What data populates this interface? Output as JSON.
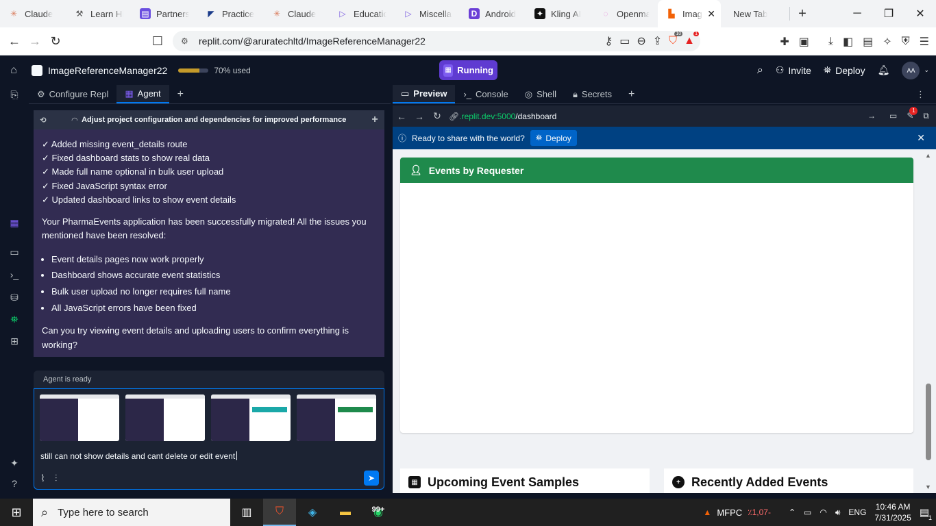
{
  "browser": {
    "tabs": [
      {
        "label": "Claude",
        "icon": "claude-icon",
        "color": "#d97757"
      },
      {
        "label": "Learn Hi",
        "icon": "learn-icon",
        "color": "#555"
      },
      {
        "label": "Partners",
        "icon": "partners-icon",
        "color": "#6b4fe0"
      },
      {
        "label": "Practice",
        "icon": "practice-icon",
        "color": "#1a3b8a"
      },
      {
        "label": "Claude",
        "icon": "claude-icon",
        "color": "#d97757"
      },
      {
        "label": "Educatio",
        "icon": "play-icon",
        "color": "#7b5ce0"
      },
      {
        "label": "Miscellar",
        "icon": "play-icon",
        "color": "#7b5ce0"
      },
      {
        "label": "Android",
        "icon": "d-icon",
        "color": "#6b3fd6"
      },
      {
        "label": "Kling AI",
        "icon": "kling-icon",
        "color": "#111"
      },
      {
        "label": "Openma",
        "icon": "openma-icon",
        "color": "#e58ad9"
      },
      {
        "label": "Imag",
        "icon": "replit-icon",
        "color": "#f26207",
        "active": true
      },
      {
        "label": "New Tab",
        "icon": "",
        "color": ""
      }
    ],
    "address": "replit.com/@aruratechltd/ImageReferenceManager22",
    "brave_badge": "10",
    "alert_badge": "1"
  },
  "replit": {
    "repl_name": "ImageReferenceManager22",
    "usage_label": "70% used",
    "usage_fraction": 0.7,
    "run_status": "Running",
    "invite_label": "Invite",
    "deploy_label": "Deploy",
    "avatar_initials": "AA"
  },
  "left_tabs": {
    "configure": "Configure Repl",
    "agent": "Agent"
  },
  "chat": {
    "header_title": "Adjust project configuration and dependencies for improved performance",
    "checklist": [
      "✓ Added missing event_details route",
      "✓ Fixed dashboard stats to show real data",
      "✓ Made full name optional in bulk user upload",
      "✓ Fixed JavaScript syntax error",
      "✓ Updated dashboard links to show event details"
    ],
    "summary": "Your PharmaEvents application has been successfully migrated! All the issues you mentioned have been resolved:",
    "bullets": [
      "Event details pages now work properly",
      "Dashboard shows accurate event statistics",
      "Bulk user upload no longer requires full name",
      "All JavaScript errors have been fixed"
    ],
    "question": "Can you try viewing event details and uploading users to confirm everything is working?",
    "status": "Agent is ready",
    "input_text": "still can not show details and cant delete or edit event"
  },
  "right_tabs": {
    "preview": "Preview",
    "console": "Console",
    "shell": "Shell",
    "secrets": "Secrets"
  },
  "preview": {
    "url_host": ".replit.dev:5000",
    "url_path": "/dashboard",
    "badge": "1",
    "banner_text": "Ready to share with the world?",
    "banner_button": "Deploy",
    "card_title": "Events by Requester",
    "card_upcoming": "Upcoming Event Samples",
    "card_recent": "Recently Added Events"
  },
  "taskbar": {
    "search_placeholder": "Type here to search",
    "badge_count": "99+",
    "ticker": "MFPC",
    "ticker_change": "٪1,07-",
    "lang": "ENG",
    "time": "10:46 AM",
    "date": "7/31/2025",
    "notifications": "1"
  }
}
